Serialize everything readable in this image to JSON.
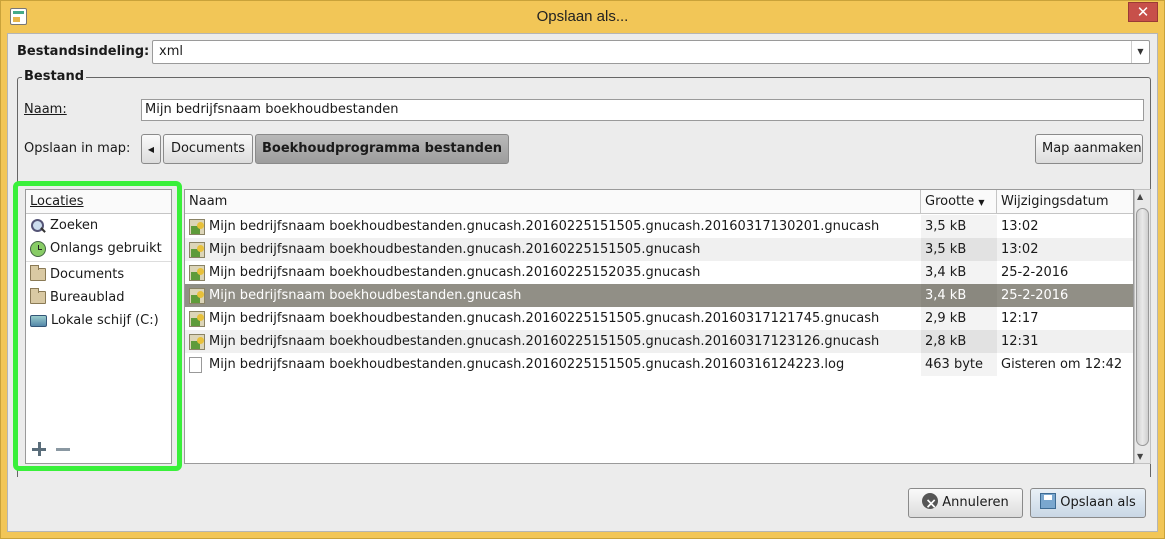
{
  "window": {
    "title": "Opslaan als..."
  },
  "format": {
    "label": "Bestandsindeling:",
    "value": "xml"
  },
  "bestand": {
    "frame_title": "Bestand",
    "name_label": "Naam:",
    "name_value": "Mijn bedrijfsnaam boekhoudbestanden",
    "save_in_label": "Opslaan in map:",
    "path": [
      "Documents",
      "Boekhoudprogramma bestanden"
    ],
    "create_folder": "Map aanmaken"
  },
  "sidebar": {
    "header": "Locaties",
    "items": [
      {
        "label": "Zoeken",
        "icon": "search-icon"
      },
      {
        "label": "Onlangs gebruikt",
        "icon": "recent-icon"
      },
      {
        "label": "Documents",
        "icon": "folder-icon"
      },
      {
        "label": "Bureaublad",
        "icon": "folder-icon"
      },
      {
        "label": "Lokale schijf (C:)",
        "icon": "drive-icon"
      }
    ]
  },
  "filelist": {
    "columns": {
      "name": "Naam",
      "size": "Grootte",
      "date": "Wijzigingsdatum"
    },
    "rows": [
      {
        "name": "Mijn bedrijfsnaam boekhoudbestanden.gnucash.20160225151505.gnucash.20160317130201.gnucash",
        "size": "3,5 kB",
        "date": "13:02"
      },
      {
        "name": "Mijn bedrijfsnaam boekhoudbestanden.gnucash.20160225151505.gnucash",
        "size": "3,5 kB",
        "date": "13:02"
      },
      {
        "name": "Mijn bedrijfsnaam boekhoudbestanden.gnucash.20160225152035.gnucash",
        "size": "3,4 kB",
        "date": "25-2-2016"
      },
      {
        "name": "Mijn bedrijfsnaam boekhoudbestanden.gnucash",
        "size": "3,4 kB",
        "date": "25-2-2016"
      },
      {
        "name": "Mijn bedrijfsnaam boekhoudbestanden.gnucash.20160225151505.gnucash.20160317121745.gnucash",
        "size": "2,9 kB",
        "date": "12:17"
      },
      {
        "name": "Mijn bedrijfsnaam boekhoudbestanden.gnucash.20160225151505.gnucash.20160317123126.gnucash",
        "size": "2,8 kB",
        "date": "12:31"
      },
      {
        "name": "Mijn bedrijfsnaam boekhoudbestanden.gnucash.20160225151505.gnucash.20160316124223.log",
        "size": "463 byte",
        "date": "Gisteren om 12:42"
      }
    ]
  },
  "buttons": {
    "cancel": "Annuleren",
    "save": "Opslaan als"
  },
  "colors": {
    "highlight": "#39f03a",
    "selection": "#918f86",
    "titlebar": "#f2c657"
  }
}
